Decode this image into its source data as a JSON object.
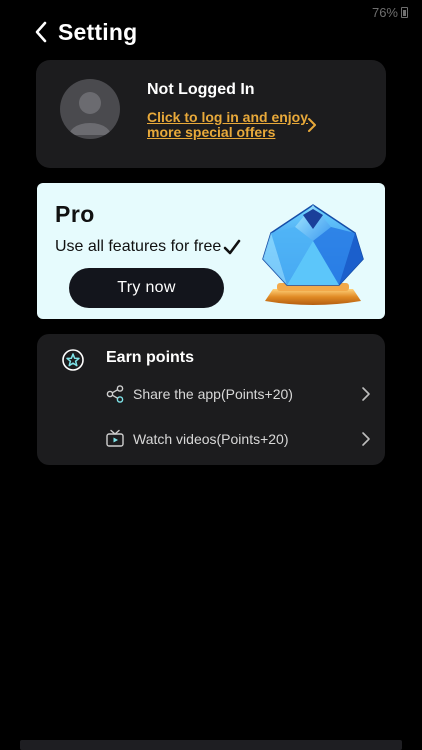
{
  "status_bar": {
    "battery": "76%"
  },
  "header": {
    "title": "Setting"
  },
  "account": {
    "status": "Not Logged In",
    "login_link": "Click to log in and enjoy more special offers"
  },
  "pro": {
    "title": "Pro",
    "description": "Use all features for free",
    "button": "Try now"
  },
  "points": {
    "title": "Earn points",
    "items": [
      {
        "label": "Share the app(Points+20)",
        "icon": "share-icon"
      },
      {
        "label": "Watch videos(Points+20)",
        "icon": "video-icon"
      }
    ]
  },
  "colors": {
    "background": "#000000",
    "card": "#1c1c1e",
    "link": "#e8a93a",
    "pro_card": "#e6fbfd",
    "accent_cyan": "#7fe3e8"
  }
}
